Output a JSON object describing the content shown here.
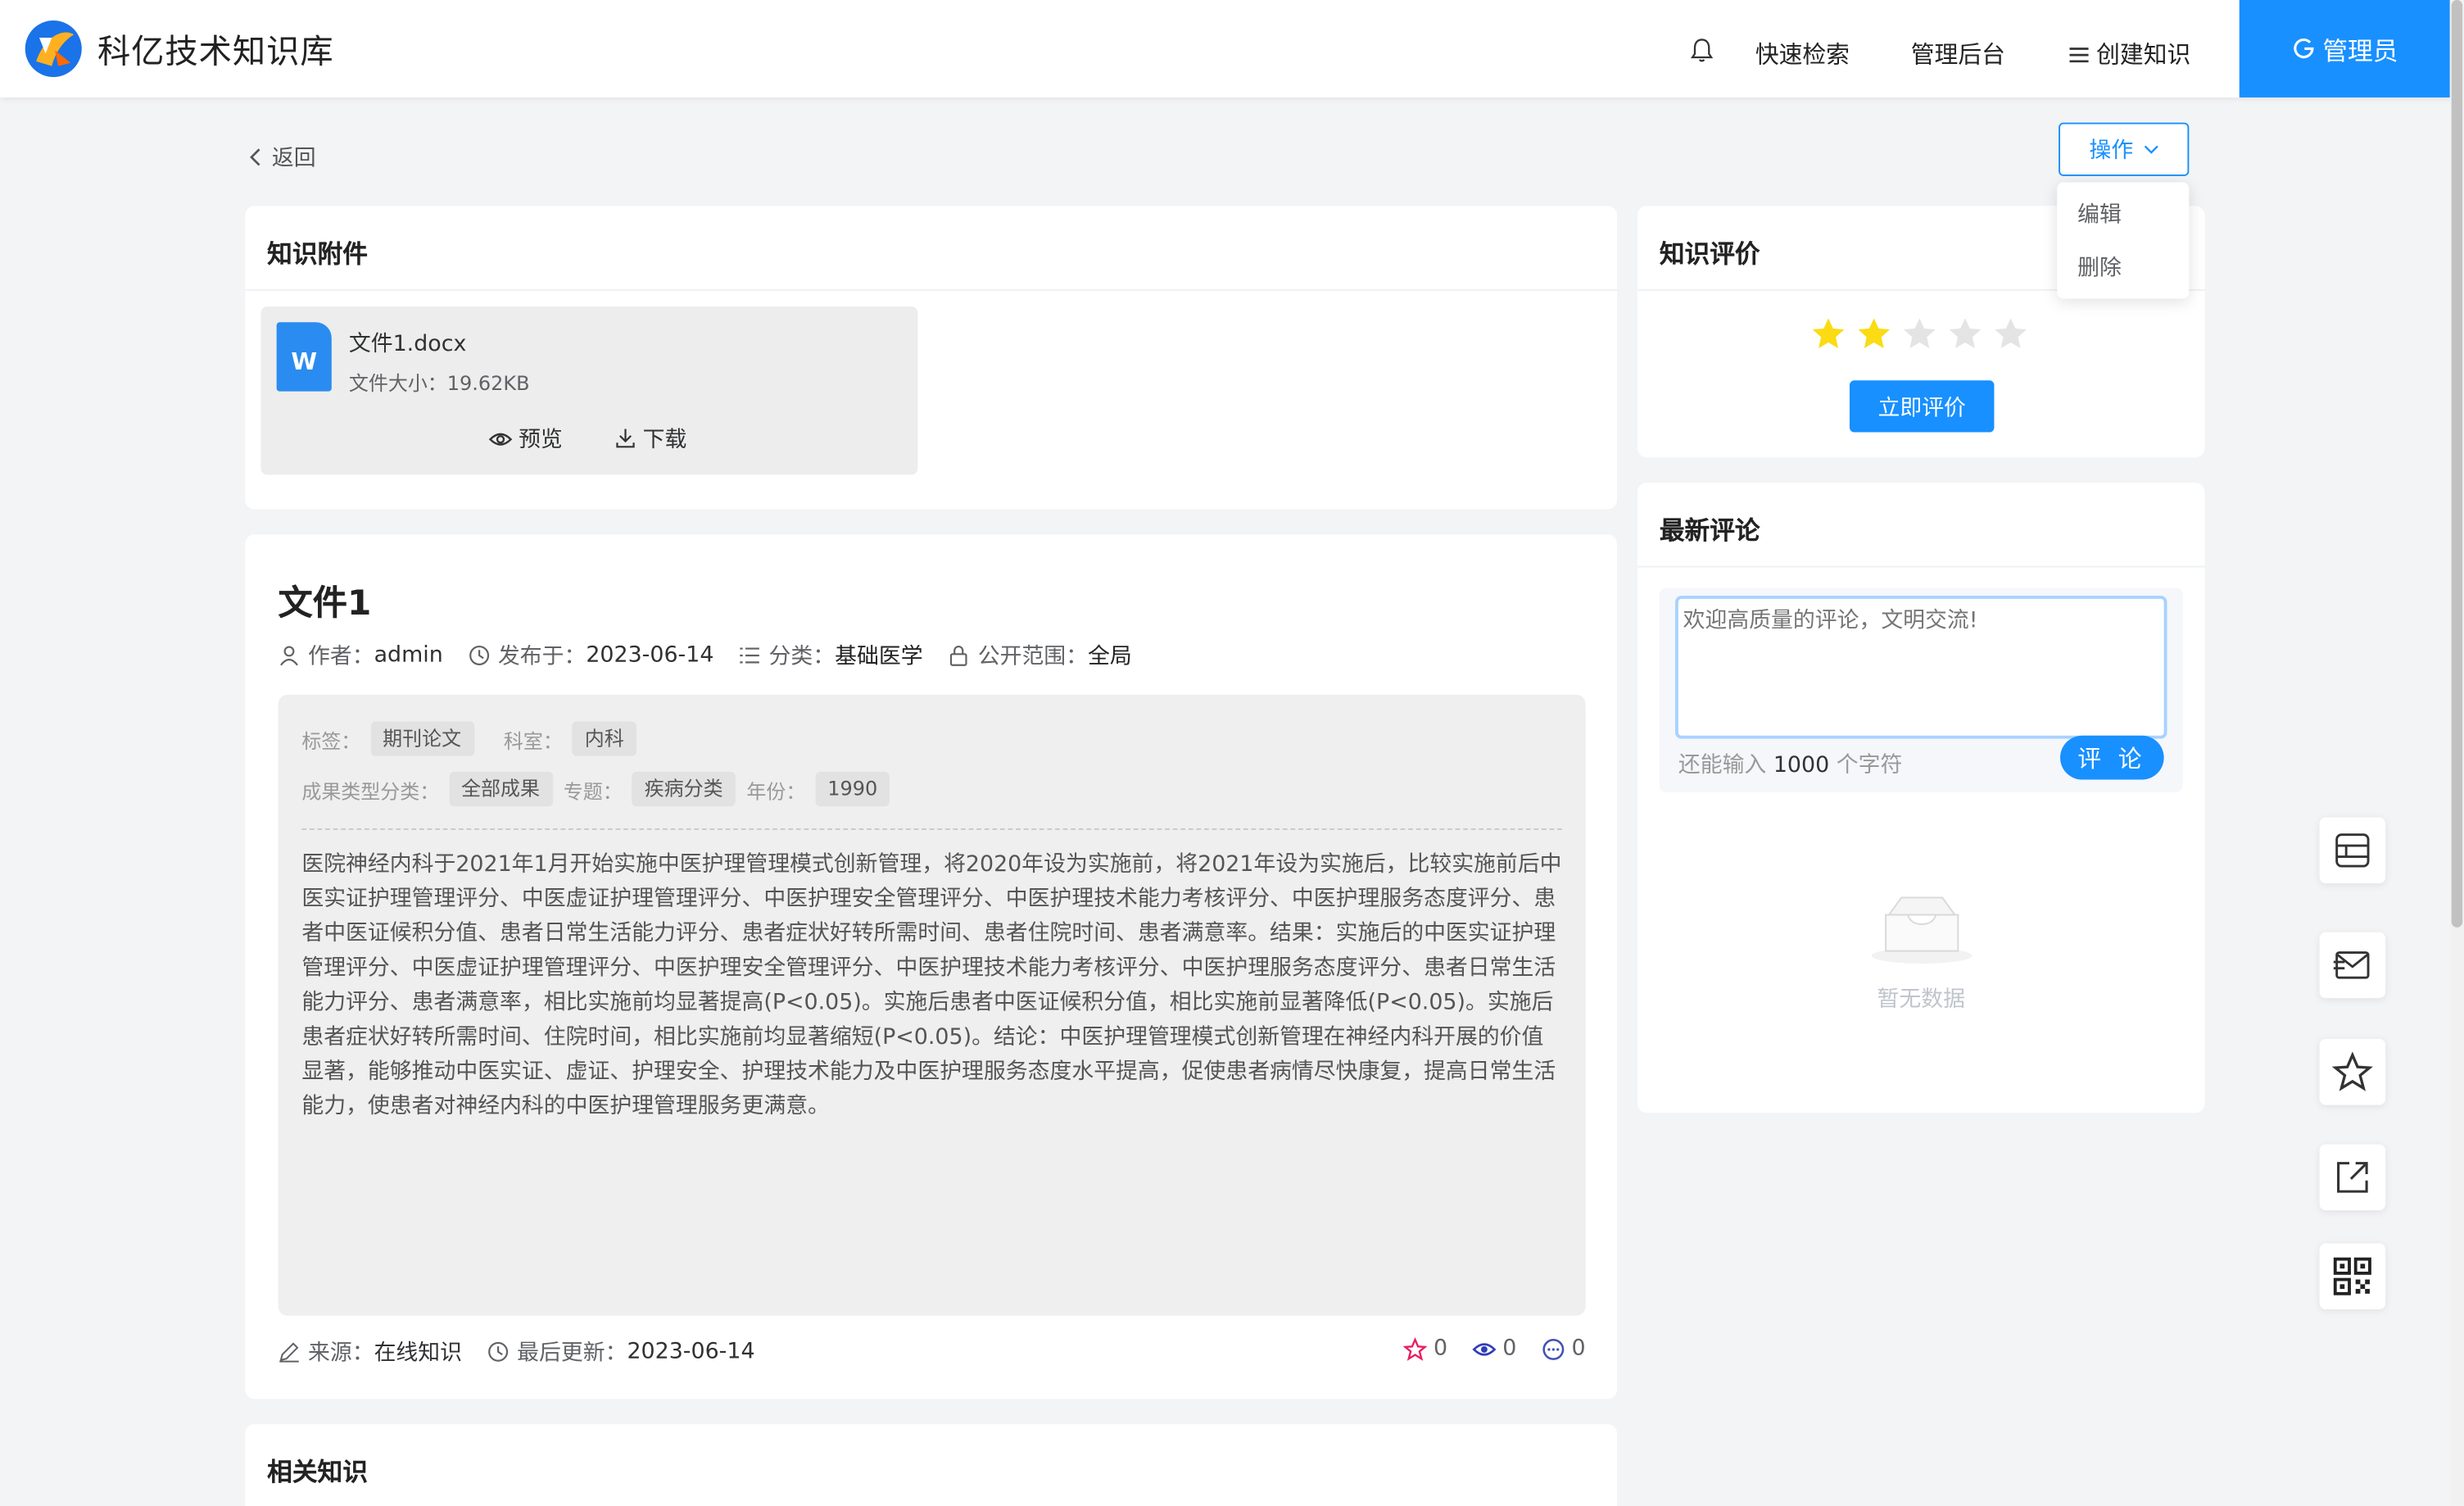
{
  "header": {
    "app_name": "科亿技术知识库",
    "links": [
      "快速检索",
      "管理后台",
      "创建知识"
    ],
    "user": "管理员"
  },
  "nav": {
    "back": "返回",
    "operation": "操作",
    "operation_menu": [
      "编辑",
      "删除"
    ]
  },
  "attachment_card": {
    "title": "知识附件",
    "file_name": "文件1.docx",
    "file_size": "文件大小：19.62KB",
    "preview": "预览",
    "download": "下载",
    "icon_letter": "W"
  },
  "document": {
    "title": "文件1",
    "author_label": "作者：",
    "author": "admin",
    "published_label": "发布于：",
    "published": "2023-06-14",
    "category_label": "分类：",
    "category": "基础医学",
    "scope_label": "公开范围：",
    "scope": "全局",
    "tags_label": "标签：",
    "tag": "期刊论文",
    "dept_label": "科室：",
    "dept": "内科",
    "result_type_label": "成果类型分类：",
    "result_type": "全部成果",
    "topic_label": "专题：",
    "topic": "疾病分类",
    "year_label": "年份：",
    "year": "1990",
    "abstract": "医院神经内科于2021年1月开始实施中医护理管理模式创新管理，将2020年设为实施前，将2021年设为实施后，比较实施前后中医实证护理管理评分、中医虚证护理管理评分、中医护理安全管理评分、中医护理技术能力考核评分、中医护理服务态度评分、患者中医证候积分值、患者日常生活能力评分、患者症状好转所需时间、患者住院时间、患者满意率。结果：实施后的中医实证护理管理评分、中医虚证护理管理评分、中医护理安全管理评分、中医护理技术能力考核评分、中医护理服务态度评分、患者日常生活能力评分、患者满意率，相比实施前均显著提高(P<0.05)。实施后患者中医证候积分值，相比实施前显著降低(P<0.05)。实施后患者症状好转所需时间、住院时间，相比实施前均显著缩短(P<0.05)。结论：中医护理管理模式创新管理在神经内科开展的价值显著，能够推动中医实证、虚证、护理安全、护理技术能力及中医护理服务态度水平提高，促使患者病情尽快康复，提高日常生活能力，使患者对神经内科的中医护理管理服务更满意。",
    "source_label": "来源：",
    "source": "在线知识",
    "updated_label": "最后更新：",
    "updated": "2023-06-14",
    "favorites": "0",
    "views": "0",
    "comments": "0"
  },
  "rating_card": {
    "title": "知识评价",
    "stars_filled": 2,
    "stars_total": 5,
    "button": "立即评价"
  },
  "comment_card": {
    "title": "最新评论",
    "placeholder": "欢迎高质量的评论，文明交流!",
    "remain_prefix": "还能输入",
    "remain_count": "1000",
    "remain_suffix": "个字符",
    "button": "评 论",
    "empty": "暂无数据"
  },
  "related_card": {
    "title": "相关知识"
  },
  "colors": {
    "primary": "#1890ff",
    "star_filled": "#fadb14",
    "star_empty": "#e4e4e4"
  }
}
